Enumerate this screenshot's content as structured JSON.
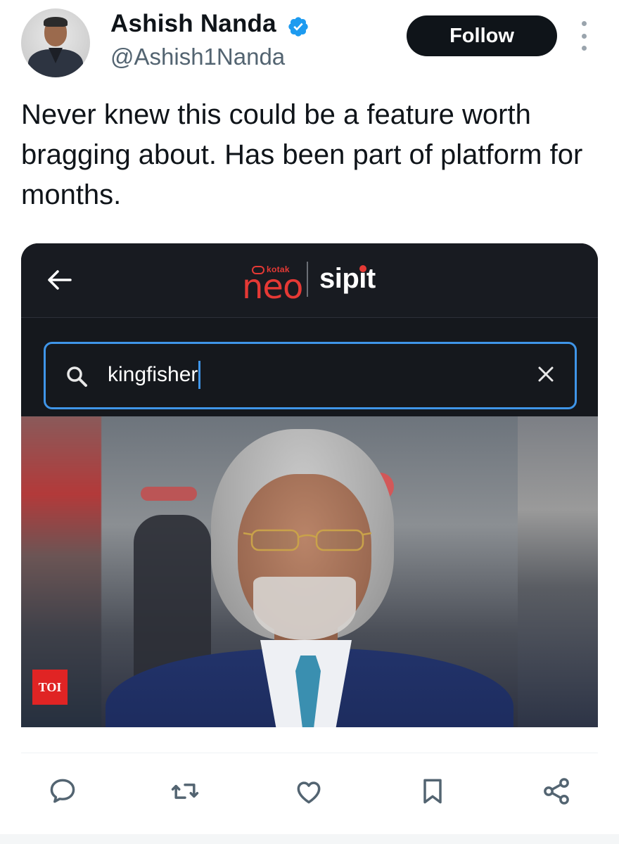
{
  "author": {
    "name": "Ashish Nanda",
    "handle": "@Ashish1Nanda",
    "verified": true
  },
  "follow_label": "Follow",
  "tweet_text": "Never knew this could be a feature worth bragging about. Has been part of platform for months.",
  "media": {
    "app": {
      "logo_small": "kotak",
      "logo_main": "neo",
      "logo_secondary": "sipit"
    },
    "search": {
      "value": "kingfisher"
    },
    "badge": "TOI"
  },
  "actions": [
    "reply-icon",
    "retweet-icon",
    "like-icon",
    "bookmark-icon",
    "share-icon"
  ],
  "colors": {
    "follow_bg": "#0f1419",
    "verified": "#1d9bf0",
    "accent_red": "#e53935",
    "search_border": "#3f95e8",
    "text_secondary": "#536471"
  }
}
